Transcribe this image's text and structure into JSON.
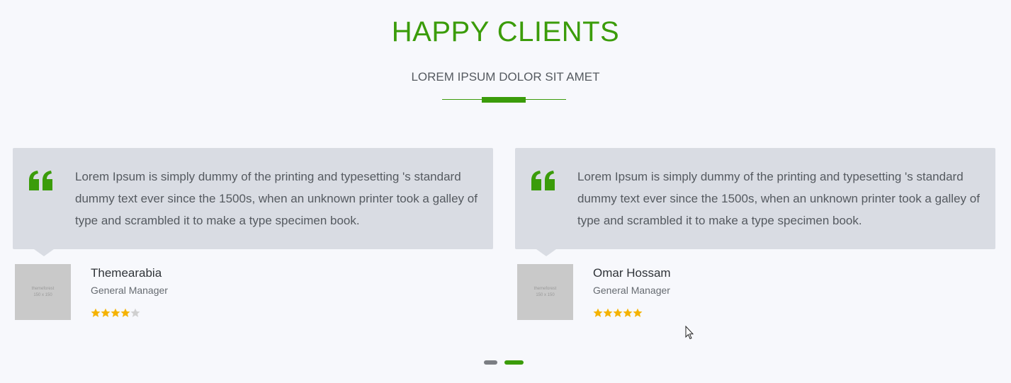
{
  "section": {
    "title": "HAPPY CLIENTS",
    "subtitle": "LOREM IPSUM DOLOR SIT AMET"
  },
  "colors": {
    "accent": "#3b9c0a",
    "bubble": "#d9dce3",
    "background": "#f7f8fc",
    "star_filled": "#f5b301",
    "star_empty": "#d0d0d0",
    "dot_inactive": "#7b7e83"
  },
  "testimonials": [
    {
      "quote_icon": "quote-icon",
      "text": "Lorem Ipsum is simply dummy of the printing and typesetting 's standard dummy text ever since the 1500s, when an unknown printer took a galley of type and scrambled it to make a type specimen book.",
      "avatar": {
        "line1": "themeforest",
        "line2": "150 x 150"
      },
      "name": "Themearabia",
      "role": "General Manager",
      "rating": 4,
      "max_rating": 5
    },
    {
      "quote_icon": "quote-icon",
      "text": "Lorem Ipsum is simply dummy of the printing and typesetting 's standard dummy text ever since the 1500s, when an unknown printer took a galley of type and scrambled it to make a type specimen book.",
      "avatar": {
        "line1": "themeforest",
        "line2": "150 x 150"
      },
      "name": "Omar Hossam",
      "role": "General Manager",
      "rating": 5,
      "max_rating": 5
    }
  ],
  "pagination": {
    "pages": 2,
    "active_page": 2
  }
}
